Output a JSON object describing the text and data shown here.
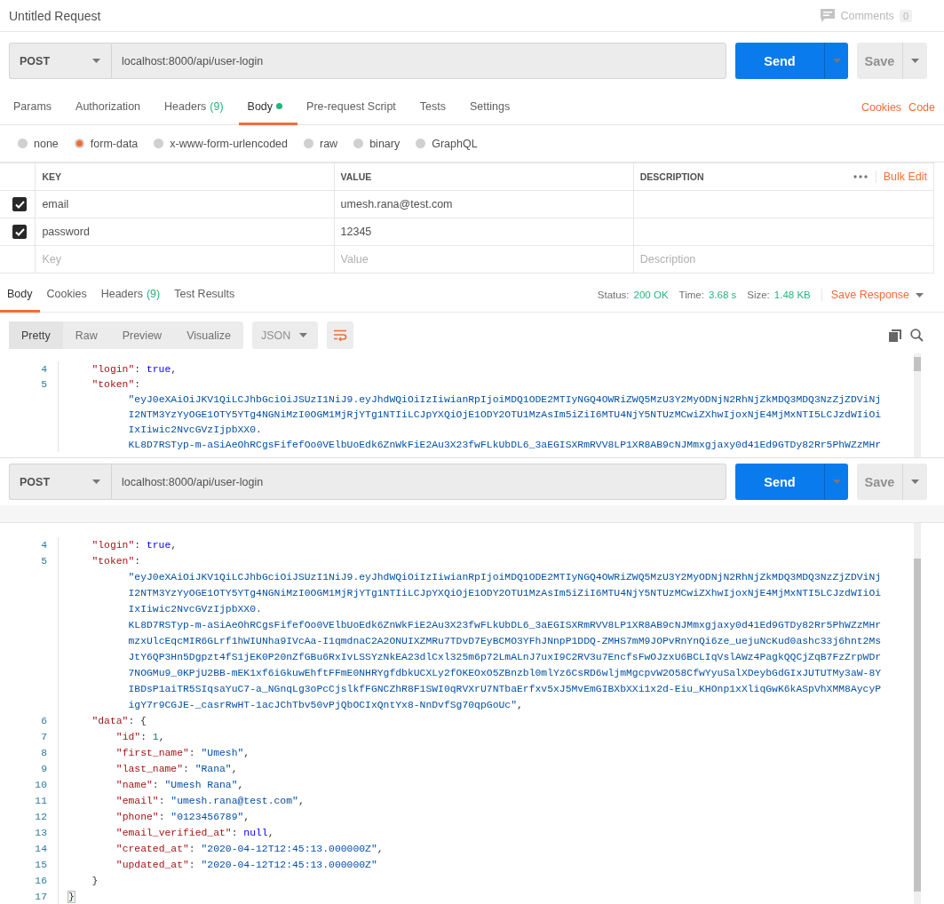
{
  "header": {
    "title": "Untitled Request",
    "comments_label": "Comments",
    "comments_count": "0"
  },
  "request_bar": {
    "method": "POST",
    "url": "localhost:8000/api/user-login",
    "send": "Send",
    "save": "Save"
  },
  "request_tabs": [
    {
      "label": "Params",
      "selected": false
    },
    {
      "label": "Authorization",
      "selected": false
    },
    {
      "label": "Headers",
      "count": "(9)",
      "selected": false
    },
    {
      "label": "Body",
      "has_content": true,
      "selected": true
    },
    {
      "label": "Pre-request Script",
      "selected": false
    },
    {
      "label": "Tests",
      "selected": false
    },
    {
      "label": "Settings",
      "selected": false
    }
  ],
  "request_links": [
    "Cookies",
    "Code"
  ],
  "body_types": [
    {
      "label": "none",
      "selected": false
    },
    {
      "label": "form-data",
      "selected": true
    },
    {
      "label": "x-www-form-urlencoded",
      "selected": false
    },
    {
      "label": "raw",
      "selected": false
    },
    {
      "label": "binary",
      "selected": false
    },
    {
      "label": "GraphQL",
      "selected": false
    }
  ],
  "params_table": {
    "columns": [
      "KEY",
      "VALUE",
      "DESCRIPTION"
    ],
    "bulk_edit": "Bulk Edit",
    "rows": [
      {
        "checked": true,
        "key": "email",
        "value": "umesh.rana@test.com"
      },
      {
        "checked": true,
        "key": "password",
        "value": "12345"
      }
    ],
    "new_row": {
      "key_placeholder": "Key",
      "value_placeholder": "Value",
      "description_placeholder": "Description"
    }
  },
  "response_tabs": [
    {
      "label": "Body",
      "selected": true
    },
    {
      "label": "Cookies",
      "selected": false
    },
    {
      "label": "Headers",
      "count": "(9)",
      "selected": false
    },
    {
      "label": "Test Results",
      "selected": false
    }
  ],
  "response_meta": [
    {
      "label": "Status:",
      "value": "200 OK"
    },
    {
      "label": "Time:",
      "value": "3.68 s"
    },
    {
      "label": "Size:",
      "value": "1.48 KB"
    }
  ],
  "save_response": "Save Response",
  "view_modes": [
    {
      "label": "Pretty",
      "selected": true
    },
    {
      "label": "Raw",
      "selected": false
    },
    {
      "label": "Preview",
      "selected": false
    },
    {
      "label": "Visualize",
      "selected": false
    }
  ],
  "format": "JSON",
  "top_viewer": {
    "lines": [
      {
        "number": "4",
        "kind": "inner",
        "segments": [
          {
            "kind": "key",
            "text": "\"login\""
          },
          {
            "kind": "punct",
            "text": ": "
          },
          {
            "kind": "bool",
            "text": "true"
          },
          {
            "kind": "punct",
            "text": ","
          }
        ]
      },
      {
        "number": "5",
        "kind": "inner",
        "segments": [
          {
            "kind": "key",
            "text": "\"token\""
          },
          {
            "kind": "punct",
            "text": ":"
          }
        ]
      },
      {
        "kind": "wrap",
        "segments": [
          {
            "kind": "str",
            "text": "\"eyJ0eXAiOiJKV1QiLCJhbGciOiJSUzI1NiJ9.eyJhdWQiOiIzIiwianRpIjoiMDQ1ODE2MTIyNGQ4OWRiZWQ5MzU3Y2MyODNjN2RhNjZkMDQ3MDQ3NzZjZDViNj"
          }
        ]
      },
      {
        "kind": "wrap",
        "segments": [
          {
            "kind": "str",
            "text": "I2NTM3YzYyOGE1OTY5YTg4NGNiMzI0OGM1MjRjYTg1NTIiLCJpYXQiOjE1ODY2OTU1MzAsIm5iZiI6MTU4NjY5NTUzMCwiZXhwIjoxNjE4MjMxNTI5LCJzdWIiOi"
          }
        ]
      },
      {
        "kind": "wrap",
        "segments": [
          {
            "kind": "str",
            "text": "IxIiwic2NvcGVzIjpbXX0."
          }
        ]
      },
      {
        "kind": "wrap",
        "segments": [
          {
            "kind": "str",
            "text": "KL8D7RSTyp-m-aSiAeOhRCgsFifefOo0VElbUoEdk6ZnWkFiE2Au3X23fwFLkUbDL6_3aEGISXRmRVV8LP1XR8AB9cNJMmxgjaxy0d41Ed9GTDy82Rr5PhWZzMHr"
          }
        ]
      }
    ]
  },
  "overlay": {
    "request_bar": {
      "method": "POST",
      "url": "localhost:8000/api/user-login",
      "send": "Send",
      "save": "Save"
    },
    "lines": [
      {
        "number": "4",
        "kind": "inner",
        "segments": [
          {
            "kind": "key",
            "text": "\"login\""
          },
          {
            "kind": "punct",
            "text": ": "
          },
          {
            "kind": "bool",
            "text": "true"
          },
          {
            "kind": "punct",
            "text": ","
          }
        ]
      },
      {
        "number": "5",
        "kind": "inner",
        "segments": [
          {
            "kind": "key",
            "text": "\"token\""
          },
          {
            "kind": "punct",
            "text": ":"
          }
        ]
      },
      {
        "kind": "wrap",
        "segments": [
          {
            "kind": "str",
            "text": "\"eyJ0eXAiOiJKV1QiLCJhbGciOiJSUzI1NiJ9.eyJhdWQiOiIzIiwianRpIjoiMDQ1ODE2MTIyNGQ4OWRiZWQ5MzU3Y2MyODNjN2RhNjZkMDQ3MDQ3NzZjZDViNj"
          }
        ]
      },
      {
        "kind": "wrap",
        "segments": [
          {
            "kind": "str",
            "text": "I2NTM3YzYyOGE1OTY5YTg4NGNiMzI0OGM1MjRjYTg1NTIiLCJpYXQiOjE1ODY2OTU1MzAsIm5iZiI6MTU4NjY5NTUzMCwiZXhwIjoxNjE4MjMxNTI5LCJzdWIiOi"
          }
        ]
      },
      {
        "kind": "wrap",
        "segments": [
          {
            "kind": "str",
            "text": "IxIiwic2NvcGVzIjpbXX0."
          }
        ]
      },
      {
        "kind": "wrap",
        "segments": [
          {
            "kind": "str",
            "text": "KL8D7RSTyp-m-aSiAeOhRCgsFifefOo0VElbUoEdk6ZnWkFiE2Au3X23fwFLkUbDL6_3aEGISXRmRVV8LP1XR8AB9cNJMmxgjaxy0d41Ed9GTDy82Rr5PhWZzMHr"
          }
        ]
      },
      {
        "kind": "wrap",
        "segments": [
          {
            "kind": "str",
            "text": "mzxUlcEqcMIR6GLrf1hWIUNha9IVcAa-I1qmdnaC2A2ONUIXZMRu7TDvD7EyBCMO3YFhJNnpP1DDQ-ZMHS7mM9JOPvRnYnQi6ze_uejuNcKud0ashc33j6hnt2Ms"
          }
        ]
      },
      {
        "kind": "wrap",
        "segments": [
          {
            "kind": "str",
            "text": "JtY6QP3Hn5Dgpzt4fS1jEK0P20nZfGBu6RxIvLSSYzNkEA23dlCxl325m6p72LmALnJ7uxI9C2RV3u7EncfsFwOJzxU6BCLIqVslAWz4PagkQQCjZqB7FzZrpWDr"
          }
        ]
      },
      {
        "kind": "wrap",
        "segments": [
          {
            "kind": "str",
            "text": "7NOGMu9_0KPjU2BB-mEK1xf6iGkuwEhftFFmE0NHRYgfdbkUCXLy2fOKEOxO5ZBnzbl0mlYz6CsRD6wljmMgcpvW2O58CfwYyuSalXDeybGdGIxJUTUTMy3aW-8Y"
          }
        ]
      },
      {
        "kind": "wrap",
        "segments": [
          {
            "kind": "str",
            "text": "IBDsP1aiTR5SIqsaYuC7-a_NGnqLg3oPcCjslkfFGNCZhR8F1SWI0qRVXrU7NTbaErfxv5xJ5MvEmGIBXbXXi1x2d-Eiu_KHOnp1xXliqGwK6kASpVhXMM8AycyP"
          }
        ]
      },
      {
        "kind": "wrap",
        "segments": [
          {
            "kind": "str",
            "text": "igY7r9CGJE-_casrRwHT-1acJChTbv50vPjQbOCIxQntYx8-NnDvfSg70qpGoUc\""
          },
          {
            "kind": "punct",
            "text": ","
          }
        ]
      },
      {
        "number": "6",
        "kind": "inner",
        "segments": [
          {
            "kind": "key",
            "text": "\"data\""
          },
          {
            "kind": "punct",
            "text": ": {"
          }
        ]
      },
      {
        "number": "7",
        "kind": "deep",
        "segments": [
          {
            "kind": "key",
            "text": "\"id\""
          },
          {
            "kind": "punct",
            "text": ": "
          },
          {
            "kind": "num",
            "text": "1"
          },
          {
            "kind": "punct",
            "text": ","
          }
        ]
      },
      {
        "number": "8",
        "kind": "deep",
        "segments": [
          {
            "kind": "key",
            "text": "\"first_name\""
          },
          {
            "kind": "punct",
            "text": ": "
          },
          {
            "kind": "str",
            "text": "\"Umesh\""
          },
          {
            "kind": "punct",
            "text": ","
          }
        ]
      },
      {
        "number": "9",
        "kind": "deep",
        "segments": [
          {
            "kind": "key",
            "text": "\"last_name\""
          },
          {
            "kind": "punct",
            "text": ": "
          },
          {
            "kind": "str",
            "text": "\"Rana\""
          },
          {
            "kind": "punct",
            "text": ","
          }
        ]
      },
      {
        "number": "10",
        "kind": "deep",
        "segments": [
          {
            "kind": "key",
            "text": "\"name\""
          },
          {
            "kind": "punct",
            "text": ": "
          },
          {
            "kind": "str",
            "text": "\"Umesh Rana\""
          },
          {
            "kind": "punct",
            "text": ","
          }
        ]
      },
      {
        "number": "11",
        "kind": "deep",
        "segments": [
          {
            "kind": "key",
            "text": "\"email\""
          },
          {
            "kind": "punct",
            "text": ": "
          },
          {
            "kind": "str",
            "text": "\"umesh.rana@test.com\""
          },
          {
            "kind": "punct",
            "text": ","
          }
        ]
      },
      {
        "number": "12",
        "kind": "deep",
        "segments": [
          {
            "kind": "key",
            "text": "\"phone\""
          },
          {
            "kind": "punct",
            "text": ": "
          },
          {
            "kind": "str",
            "text": "\"0123456789\""
          },
          {
            "kind": "punct",
            "text": ","
          }
        ]
      },
      {
        "number": "13",
        "kind": "deep",
        "segments": [
          {
            "kind": "key",
            "text": "\"email_verified_at\""
          },
          {
            "kind": "punct",
            "text": ": "
          },
          {
            "kind": "bool",
            "text": "null"
          },
          {
            "kind": "punct",
            "text": ","
          }
        ]
      },
      {
        "number": "14",
        "kind": "deep",
        "segments": [
          {
            "kind": "key",
            "text": "\"created_at\""
          },
          {
            "kind": "punct",
            "text": ": "
          },
          {
            "kind": "str",
            "text": "\"2020-04-12T12:45:13.000000Z\""
          },
          {
            "kind": "punct",
            "text": ","
          }
        ]
      },
      {
        "number": "15",
        "kind": "deep",
        "segments": [
          {
            "kind": "key",
            "text": "\"updated_at\""
          },
          {
            "kind": "punct",
            "text": ": "
          },
          {
            "kind": "str",
            "text": "\"2020-04-12T12:45:13.000000Z\""
          }
        ]
      },
      {
        "number": "16",
        "kind": "inner",
        "segments": [
          {
            "kind": "punct",
            "text": "}"
          }
        ]
      },
      {
        "number": "17",
        "kind": "root",
        "segments": [
          {
            "kind": "bracket",
            "text": "}"
          }
        ]
      }
    ]
  }
}
